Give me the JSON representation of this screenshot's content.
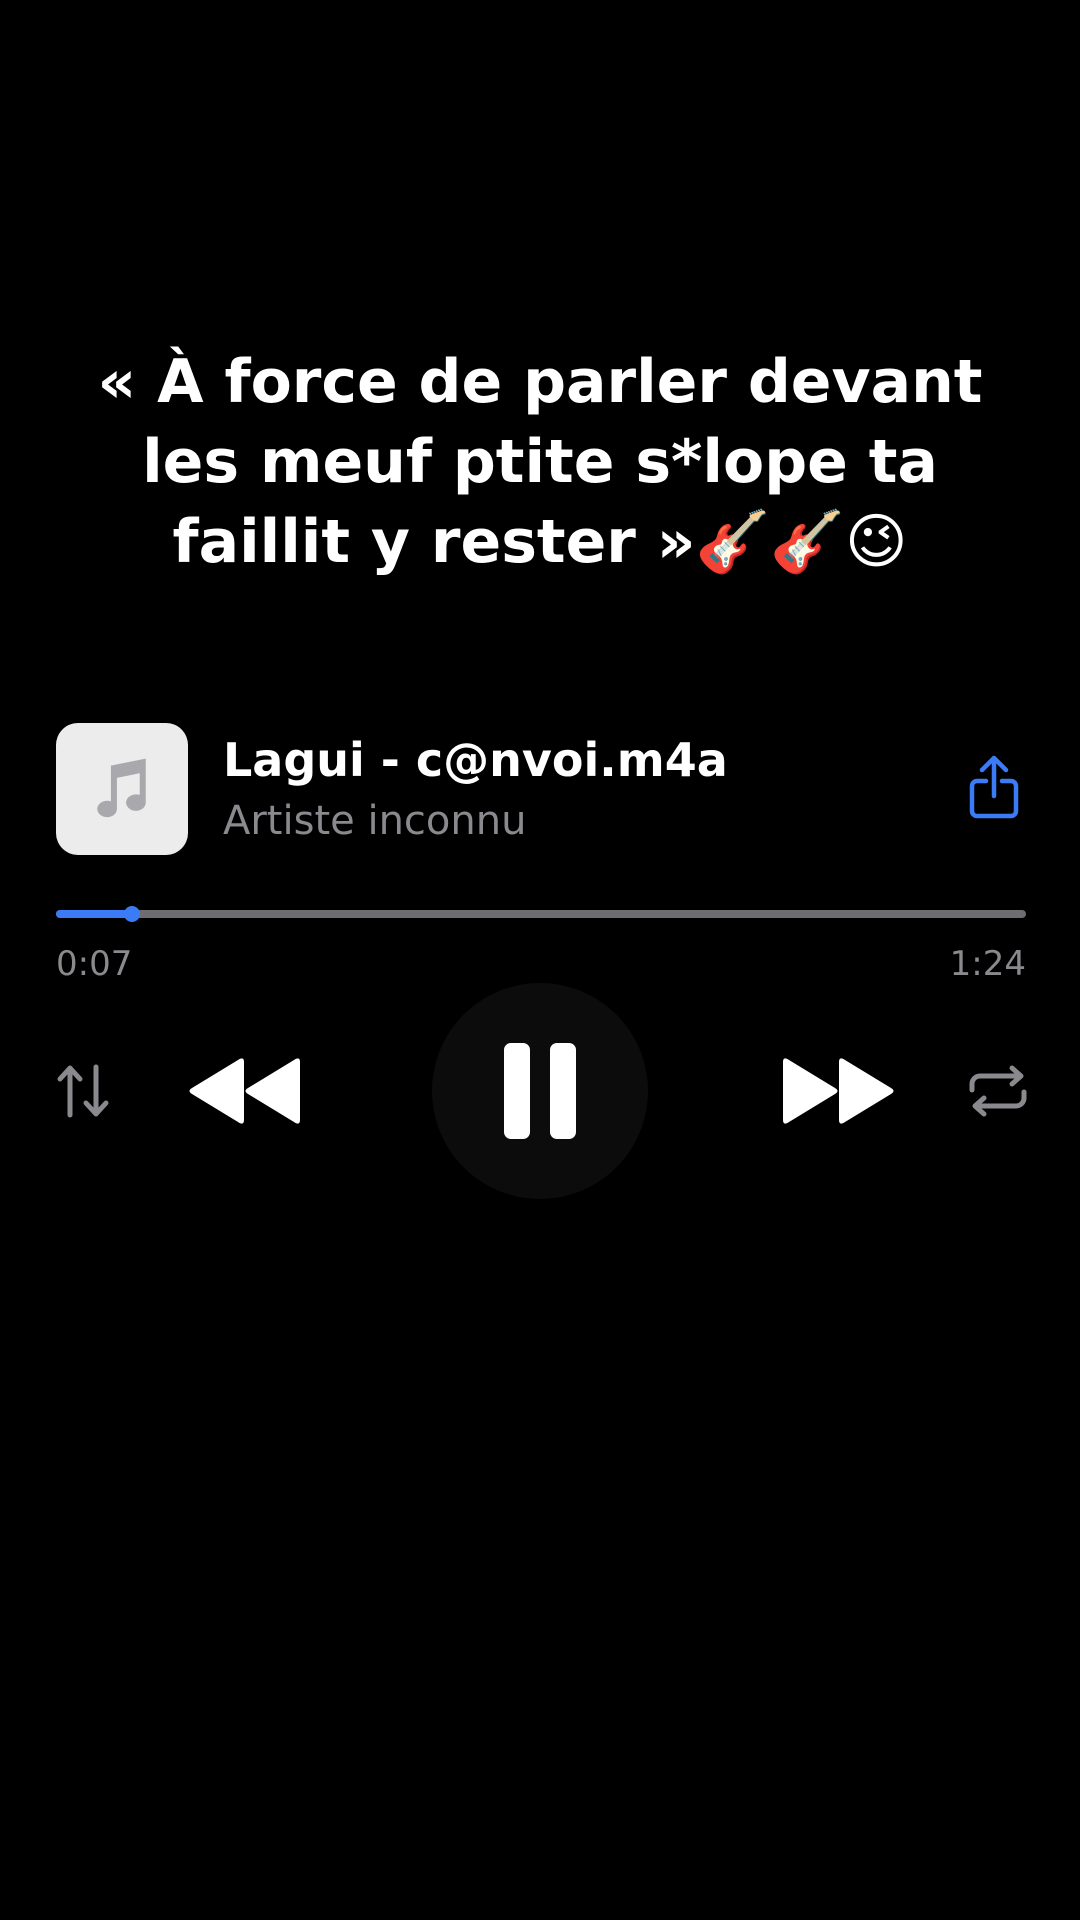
{
  "caption": {
    "line1": "« À force de parler devant",
    "line2": "les meuf ptite s*lope ta",
    "line3_text": "faillit y rester »",
    "line3_emoji": "🎸🎸😉"
  },
  "track": {
    "title": "Lagui - c@nvoi.m4a",
    "artist": "Artiste inconnu",
    "artwork_icon": "music-note-icon"
  },
  "playback": {
    "elapsed": "0:07",
    "total": "1:24",
    "progress_fraction": 0.078,
    "state": "playing"
  },
  "controls": {
    "icons": [
      "sort-arrows-icon",
      "rewind-icon",
      "pause-icon",
      "fast-forward-icon",
      "repeat-icon"
    ]
  },
  "colors": {
    "background": "#000000",
    "accent": "#3b7bf6",
    "secondary_text": "#8a8a8e",
    "track_background": "#6e6e70",
    "artwork_background": "#ececec"
  }
}
